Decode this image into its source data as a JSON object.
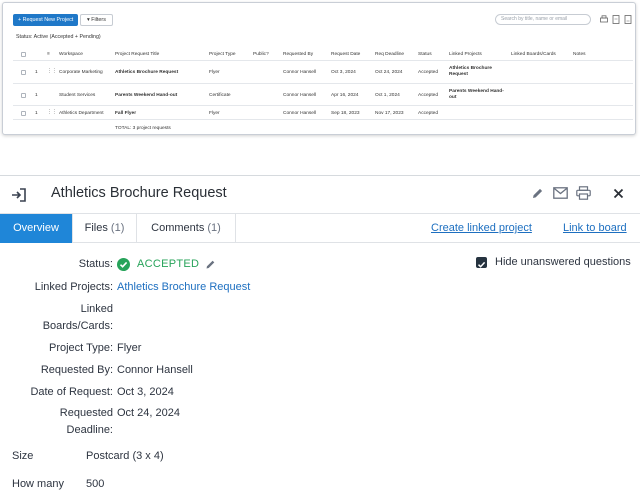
{
  "list": {
    "new_button": "+ Request New Project",
    "filters_button": "Filters",
    "search_placeholder": "Search by title, name or email",
    "status_line": "Status: Active (Accepted + Pending)",
    "columns": [
      "Workspace",
      "Project Request Title",
      "Project Type",
      "Public?",
      "Requested By",
      "Request Date",
      "Req Deadline",
      "Status",
      "Linked Projects",
      "Linked Boards/Cards",
      "Notes"
    ],
    "rows": [
      {
        "num": "1",
        "workspace": "Corporate Marketing",
        "title": "Athletics Brochure Request",
        "type": "Flyer",
        "requested_by": "Connor Hansell",
        "request_date": "Oct 3, 2024",
        "deadline": "Oct 24, 2024",
        "status": "Accepted",
        "linked": "Athletics Brochure Request"
      },
      {
        "num": "1",
        "workspace": "Student Services",
        "title": "Parents Weekend Hand-out",
        "type": "Certificate",
        "requested_by": "Connor Hansell",
        "request_date": "Apr 16, 2024",
        "deadline": "Oct 1, 2024",
        "status": "Accepted",
        "linked": "Parents Weekend Hand-out"
      },
      {
        "num": "1",
        "workspace": "Athletics Department",
        "title": "Fall Flyer",
        "type": "Flyer",
        "requested_by": "Connor Hansell",
        "request_date": "Sep 18, 2023",
        "deadline": "Nov 17, 2023",
        "status": "Accepted",
        "linked": ""
      }
    ],
    "total": "TOTAL: 3 project requests"
  },
  "detail": {
    "title": "Athletics Brochure Request",
    "tabs": {
      "overview": "Overview",
      "files": "Files",
      "files_count": "(1)",
      "comments": "Comments",
      "comments_count": "(1)"
    },
    "create_linked_project": "Create linked project",
    "link_to_board": "Link to board",
    "hide_unanswered": "Hide unanswered questions",
    "fields": {
      "status_label": "Status:",
      "status_value": "ACCEPTED",
      "linked_projects_label": "Linked Projects:",
      "linked_projects_value": "Athletics Brochure Request",
      "linked_boards_label_1": "Linked",
      "linked_boards_label_2": "Boards/Cards:",
      "project_type_label": "Project Type:",
      "project_type_value": "Flyer",
      "requested_by_label": "Requested By:",
      "requested_by_value": "Connor Hansell",
      "date_of_request_label": "Date of Request:",
      "date_of_request_value": "Oct 3, 2024",
      "requested_deadline_label_1": "Requested",
      "requested_deadline_label_2": "Deadline:",
      "requested_deadline_value": "Oct 24, 2024",
      "size_label": "Size",
      "size_value": "Postcard (3 x 4)",
      "how_many_label": "How many",
      "how_many_value": "500"
    }
  },
  "colors": {
    "accent": "#1f86d8",
    "link": "#1d6fc0",
    "accepted": "#27a35a"
  }
}
